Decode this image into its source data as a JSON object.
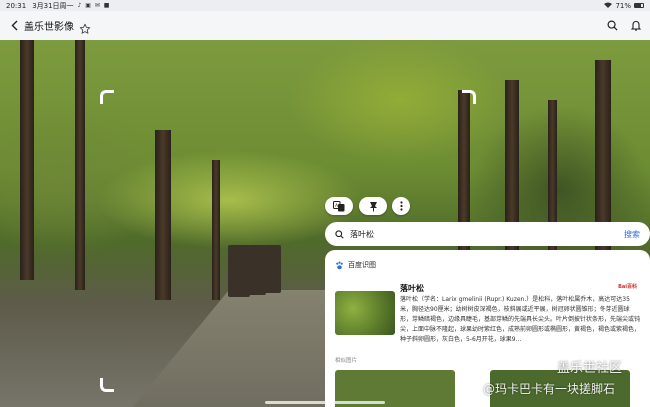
{
  "status_bar": {
    "time": "20:31",
    "date": "3月31日周一",
    "battery_text": "71%",
    "battery_level": 0.71
  },
  "app_bar": {
    "title": "盖乐世影像"
  },
  "search": {
    "query": "落叶松",
    "action_label": "搜索"
  },
  "result_card": {
    "source_label": "百度识图",
    "name": "落叶松",
    "description": "落叶松（学名：Larix gmelinii (Rupr.) Kuzen.）是松科，落叶松属乔木，高达可达35米，胸径达90厘米；幼树树皮深褐色，枝斜展或近平展，树冠卵状圆锥形；冬芽近圆球形，芽鳞暗褐色，边缘具睫毛，基部芽鳞的先端具长尖头。叶片倒披针状条形，先端尖或钝尖，上面中脉不隆起，球果幼时紫红色，成熟前卵圆形或椭圆形，黄褐色，褐色或紫褐色，种子斜卵圆形，灰白色，5-6月开花，球果9...",
    "similar_label": "相似图片"
  },
  "watermark": {
    "line1": "盖乐世社区",
    "line2": "@玛卡巴卡有一块搓脚石"
  },
  "icons": [
    "back-icon",
    "star-icon",
    "search-icon",
    "bell-icon",
    "translate-icon",
    "pin-icon",
    "more-icon",
    "baidu-paw-icon"
  ],
  "colors": {
    "accent": "#2b6de0",
    "baidu_red": "#d8282b"
  }
}
